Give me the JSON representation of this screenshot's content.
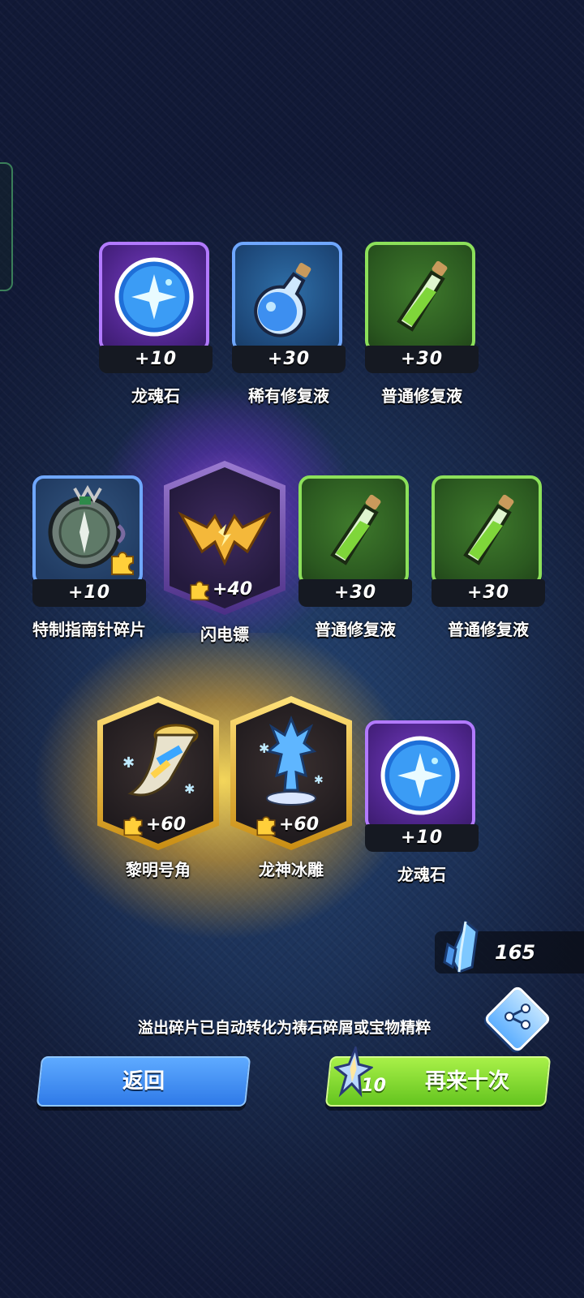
{
  "rewards": [
    {
      "name": "龙魂石",
      "amount": "+10",
      "rarity": "purple",
      "icon": "dragon-soul-orb-icon"
    },
    {
      "name": "稀有修复液",
      "amount": "+30",
      "rarity": "blue",
      "icon": "blue-potion-icon"
    },
    {
      "name": "普通修复液",
      "amount": "+30",
      "rarity": "green",
      "icon": "green-potion-icon"
    },
    {
      "name": "特制指南针碎片",
      "amount": "+10",
      "rarity": "blue",
      "icon": "compass-icon"
    },
    {
      "name": "闪电镖",
      "amount": "+40",
      "rarity": "purple-hex",
      "icon": "lightning-dart-icon"
    },
    {
      "name": "普通修复液",
      "amount": "+30",
      "rarity": "green",
      "icon": "green-potion-icon"
    },
    {
      "name": "普通修复液",
      "amount": "+30",
      "rarity": "green",
      "icon": "green-potion-icon"
    },
    {
      "name": "黎明号角",
      "amount": "+60",
      "rarity": "gold-hex",
      "icon": "dawn-horn-icon"
    },
    {
      "name": "龙神冰雕",
      "amount": "+60",
      "rarity": "gold-hex",
      "icon": "ice-dragon-statue-icon"
    },
    {
      "name": "龙魂石",
      "amount": "+10",
      "rarity": "purple",
      "icon": "dragon-soul-orb-icon"
    }
  ],
  "currency": {
    "value": "165",
    "icon": "crystal-icon"
  },
  "notice": "溢出碎片已自动转化为祷石碎屑或宝物精粹",
  "buttons": {
    "back": "返回",
    "again": "再来十次",
    "again_cost": "10"
  },
  "colors": {
    "purple": "#b27aff",
    "blue": "#6fa7ff",
    "green": "#8ce05a",
    "gold": "#ffd24a"
  }
}
